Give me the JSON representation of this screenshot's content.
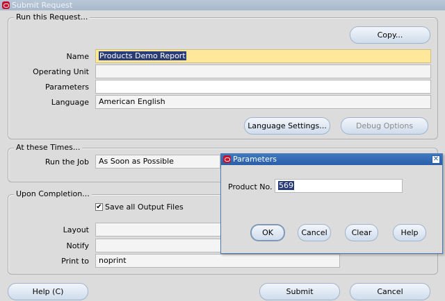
{
  "window": {
    "title": "Submit Request"
  },
  "run_request": {
    "group_label": "Run this Request...",
    "copy_button": "Copy...",
    "fields": {
      "name": {
        "label": "Name",
        "value": "Products Demo Report"
      },
      "operating_unit": {
        "label": "Operating Unit",
        "value": ""
      },
      "parameters": {
        "label": "Parameters",
        "value": ""
      },
      "language": {
        "label": "Language",
        "value": "American English"
      }
    },
    "language_settings_button": "Language Settings...",
    "debug_options_button": "Debug Options"
  },
  "times": {
    "group_label": "At these Times...",
    "run_job": {
      "label": "Run the Job",
      "value": "As Soon as Possible"
    }
  },
  "completion": {
    "group_label": "Upon Completion...",
    "save_output": {
      "label": "Save all Output Files",
      "checked": true,
      "check_glyph": "✔"
    },
    "layout": {
      "label": "Layout",
      "value": ""
    },
    "notify": {
      "label": "Notify",
      "value": ""
    },
    "print_to": {
      "label": "Print to",
      "value": "noprint"
    }
  },
  "footer": {
    "help_button": "Help (C)",
    "submit_button": "Submit",
    "cancel_button": "Cancel"
  },
  "parameters_dialog": {
    "title": "Parameters",
    "close_glyph": "✕",
    "product_no": {
      "label": "Product No.",
      "value": "569"
    },
    "buttons": {
      "ok": "OK",
      "cancel": "Cancel",
      "clear": "Clear",
      "help": "Help"
    }
  },
  "colors": {
    "required_field": "#ffe89a",
    "dialog_titlebar": "#2a5ea8",
    "selection": "#2a3c78"
  }
}
